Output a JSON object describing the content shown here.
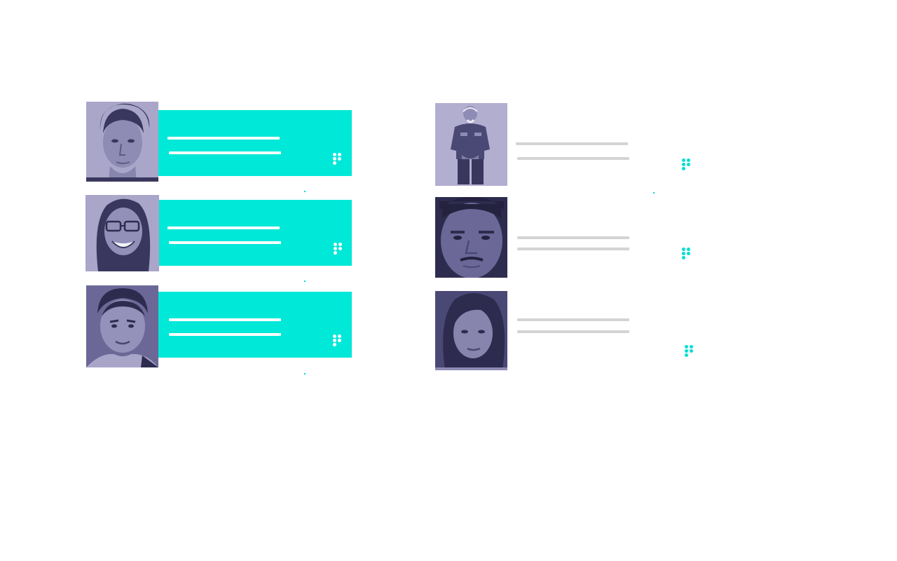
{
  "palette": {
    "accent": "#00e8d8",
    "photo_tint": "#3c3a6e",
    "line_light": "#ffffff",
    "line_gray": "#d4d4d4"
  },
  "columns": [
    {
      "style": "filled",
      "cards": [
        {
          "photo": "portrait-young-man"
        },
        {
          "photo": "portrait-woman-glasses"
        },
        {
          "photo": "portrait-man-smiling"
        }
      ]
    },
    {
      "style": "plain",
      "cards": [
        {
          "photo": "portrait-older-man-standing"
        },
        {
          "photo": "portrait-man-closeup"
        },
        {
          "photo": "portrait-woman-dark-hair"
        }
      ]
    }
  ]
}
